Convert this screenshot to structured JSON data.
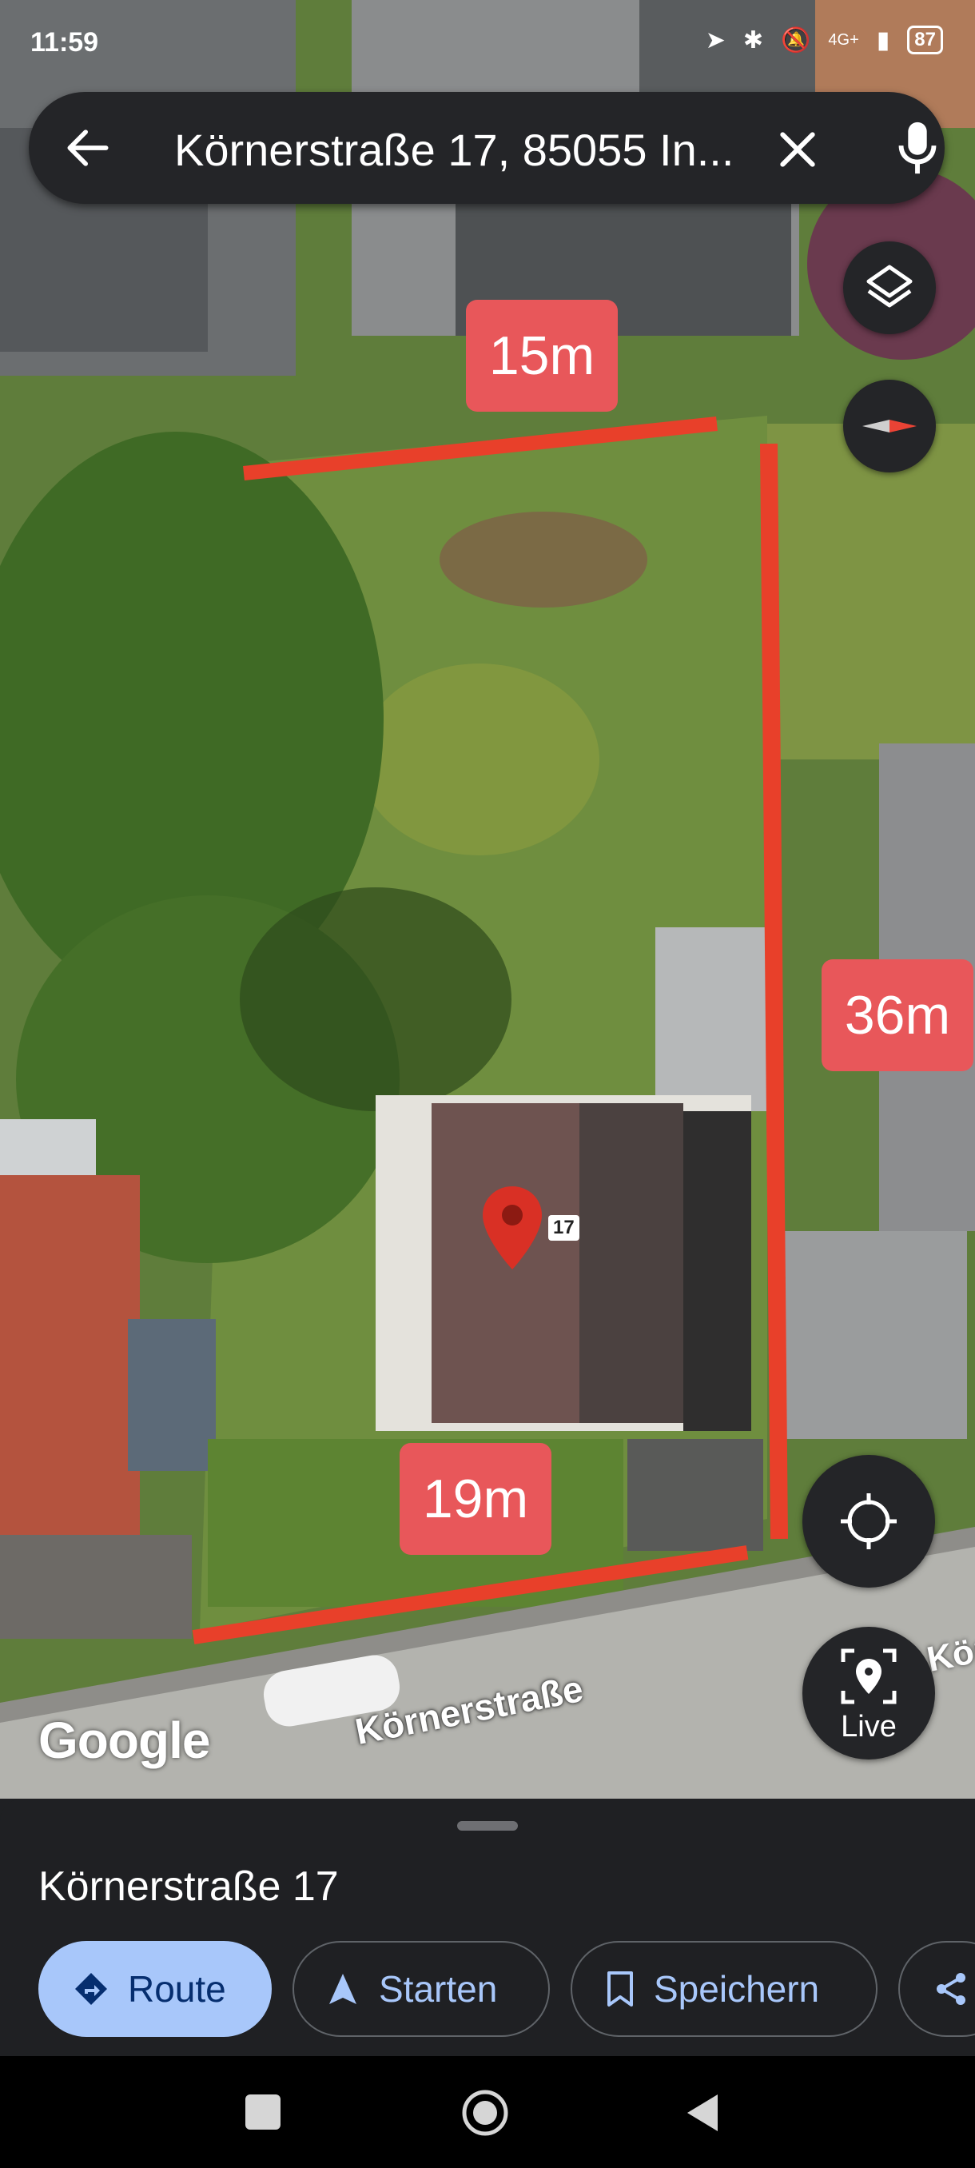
{
  "status_bar": {
    "time": "11:59",
    "network": "4G+",
    "battery": "87"
  },
  "search": {
    "query": "Körnerstraße 17, 85055 In..."
  },
  "map": {
    "measurements": {
      "top": "15m",
      "right": "36m",
      "bottom": "19m"
    },
    "house_number": "17",
    "street_label": "Körnerstraße",
    "street_label_right": "Kör",
    "attribution": "Google",
    "live_label": "Live",
    "line_color": "#e8402a",
    "label_color": "#e8575a"
  },
  "sheet": {
    "place_name": "Körnerstraße 17",
    "actions": {
      "route": "Route",
      "start": "Starten",
      "save": "Speichern"
    }
  },
  "colors": {
    "accent": "#a8c7fa",
    "surface": "#242528",
    "pin": "#d93025"
  }
}
